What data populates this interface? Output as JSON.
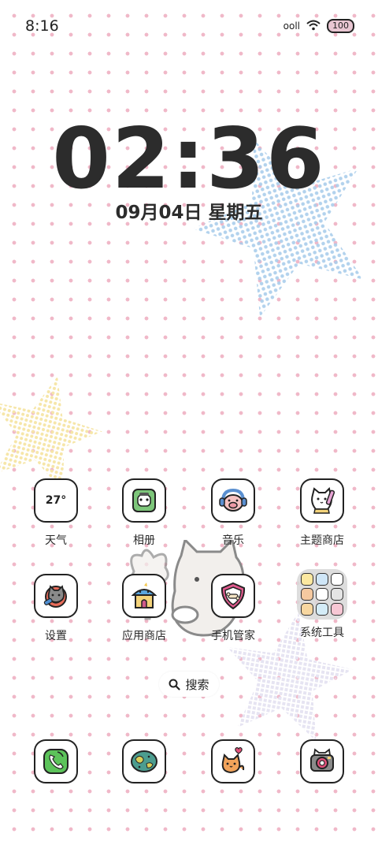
{
  "status_bar": {
    "time": "8:16",
    "signal_text": "ooll",
    "wifi_icon": "wifi-icon",
    "battery": "100"
  },
  "lock_clock": {
    "time": "02:36",
    "date": "09月04日 星期五"
  },
  "apps_row1": [
    {
      "label": "天气",
      "icon_text": "27°",
      "icon": "weather-icon"
    },
    {
      "label": "相册",
      "icon": "gallery-icon"
    },
    {
      "label": "音乐",
      "icon": "music-pig-icon"
    },
    {
      "label": "主题商店",
      "icon": "theme-store-cat-icon"
    }
  ],
  "apps_row2": [
    {
      "label": "设置",
      "icon": "settings-icon"
    },
    {
      "label": "应用商店",
      "icon": "app-store-house-icon"
    },
    {
      "label": "手机管家",
      "icon": "phone-manager-icon"
    },
    {
      "label": "系统工具",
      "icon": "system-tools-folder-icon"
    }
  ],
  "search": {
    "label": "搜索"
  },
  "dock": [
    {
      "icon": "phone-icon"
    },
    {
      "icon": "browser-globe-icon"
    },
    {
      "icon": "messages-cat-icon"
    },
    {
      "icon": "camera-icon"
    }
  ],
  "colors": {
    "dots": "#f0b8c8",
    "phone_green": "#5cc35a",
    "folder_bg": "#d7d7d7"
  }
}
